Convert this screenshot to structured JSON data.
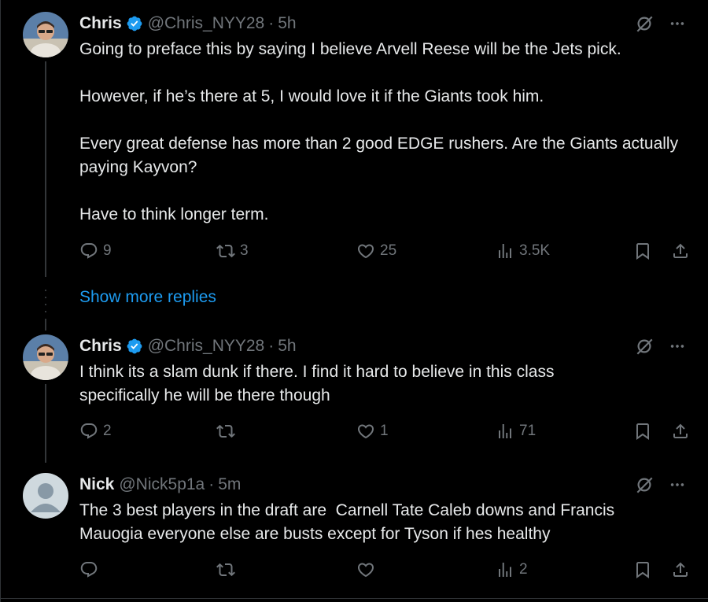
{
  "tweets": [
    {
      "name": "Chris",
      "handle": "@Chris_NYY28",
      "time": "5h",
      "text": "Going to preface this by saying I believe Arvell Reese will be the Jets pick.\n\nHowever, if he’s there at 5, I would love it if the Giants took him.\n\nEvery great defense has more than 2 good EDGE rushers. Are the Giants actually paying Kayvon?\n\nHave to think longer term.",
      "replies": "9",
      "reposts": "3",
      "likes": "25",
      "views": "3.5K"
    },
    {
      "name": "Chris",
      "handle": "@Chris_NYY28",
      "time": "5h",
      "text": "I think its a slam dunk if there. I find it hard to believe in this class specifically he will be there though",
      "replies": "2",
      "reposts": "",
      "likes": "1",
      "views": "71"
    },
    {
      "name": "Nick",
      "handle": "@Nick5p1a",
      "time": "5m",
      "text": "The 3 best players in the draft are  Carnell Tate Caleb downs and Francis Mauogia everyone else are busts except for Tyson if hes healthy",
      "replies": "",
      "reposts": "",
      "likes": "",
      "views": "2"
    }
  ],
  "separator_dot": "·",
  "show_more": "Show more replies",
  "colors": {
    "background": "#000000",
    "text": "#e7e9ea",
    "muted": "#71767b",
    "link": "#1d9bf0",
    "verified": "#1d9bf0"
  },
  "icons": [
    "verified-badge-icon",
    "grok-icon",
    "more-icon",
    "reply-icon",
    "repost-icon",
    "like-icon",
    "views-icon",
    "bookmark-icon",
    "share-icon"
  ]
}
